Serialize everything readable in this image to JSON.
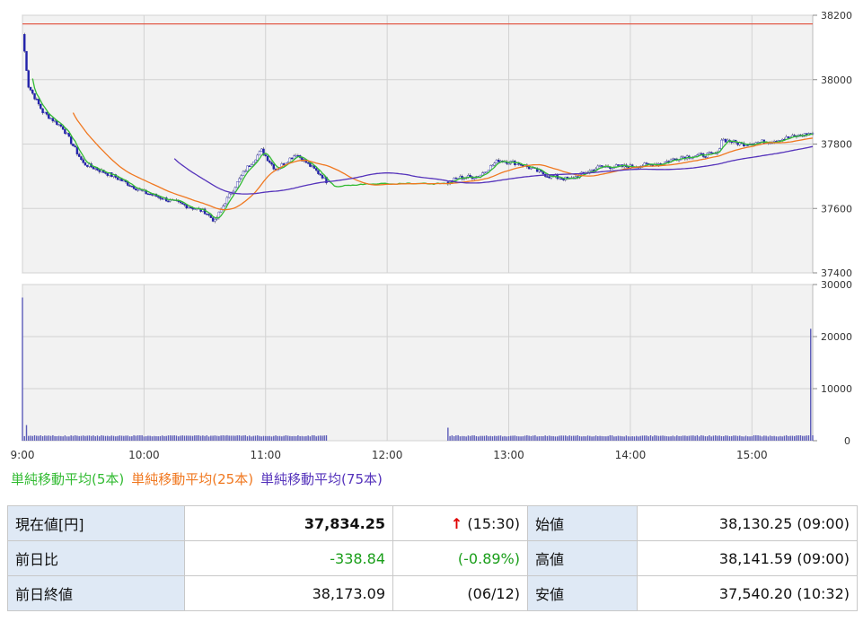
{
  "chart_data": [
    {
      "type": "candlestick-line",
      "x_ticks": [
        "9:00",
        "10:00",
        "11:00",
        "12:00",
        "13:00",
        "14:00",
        "15:00"
      ],
      "y_ticks": [
        37400,
        37600,
        37800,
        38000,
        38200
      ],
      "ylim": [
        37400,
        38200
      ],
      "prev_close": 38173.09,
      "grid": true,
      "price_keypoints": [
        [
          0,
          38141
        ],
        [
          3,
          37980
        ],
        [
          10,
          37900
        ],
        [
          20,
          37850
        ],
        [
          30,
          37740
        ],
        [
          45,
          37700
        ],
        [
          60,
          37650
        ],
        [
          75,
          37620
        ],
        [
          90,
          37590
        ],
        [
          95,
          37560
        ],
        [
          100,
          37620
        ],
        [
          110,
          37720
        ],
        [
          118,
          37780
        ],
        [
          125,
          37720
        ],
        [
          135,
          37770
        ],
        [
          148,
          37700
        ],
        [
          152,
          37670
        ],
        [
          210,
          37680
        ],
        [
          215,
          37695
        ],
        [
          225,
          37700
        ],
        [
          235,
          37750
        ],
        [
          245,
          37740
        ],
        [
          260,
          37700
        ],
        [
          270,
          37690
        ],
        [
          285,
          37730
        ],
        [
          300,
          37730
        ],
        [
          315,
          37740
        ],
        [
          325,
          37760
        ],
        [
          335,
          37765
        ],
        [
          343,
          37770
        ],
        [
          345,
          37815
        ],
        [
          355,
          37800
        ],
        [
          370,
          37810
        ],
        [
          390,
          37834
        ]
      ],
      "series": [
        {
          "name": "単純移動平均(5本)",
          "color": "#33bb33"
        },
        {
          "name": "単純移動平均(25本)",
          "color": "#f07820"
        },
        {
          "name": "単純移動平均(75本)",
          "color": "#5533bb"
        }
      ]
    },
    {
      "type": "bar",
      "y_ticks": [
        0,
        10000,
        20000,
        30000
      ],
      "ylim": [
        0,
        30000
      ],
      "volume_spikes": [
        [
          0,
          27500
        ],
        [
          2,
          3000
        ],
        [
          210,
          2500
        ],
        [
          389,
          21500
        ]
      ],
      "volume_base": 800,
      "color": "#5b5bb8"
    }
  ],
  "legend": [
    "単純移動平均(5本)",
    "単純移動平均(25本)",
    "単純移動平均(75本)"
  ],
  "quote": {
    "current_label": "現在値[円]",
    "current_value": "37,834.25",
    "current_arrow": "↑",
    "current_time": "(15:30)",
    "change_label": "前日比",
    "change_value": "-338.84",
    "change_pct": "(-0.89%)",
    "prev_label": "前日終値",
    "prev_value": "38,173.09",
    "prev_date": "(06/12)",
    "open_label": "始値",
    "open_value": "38,130.25 (09:00)",
    "high_label": "高値",
    "high_value": "38,141.59 (09:00)",
    "low_label": "安値",
    "low_value": "37,540.20 (10:32)"
  }
}
